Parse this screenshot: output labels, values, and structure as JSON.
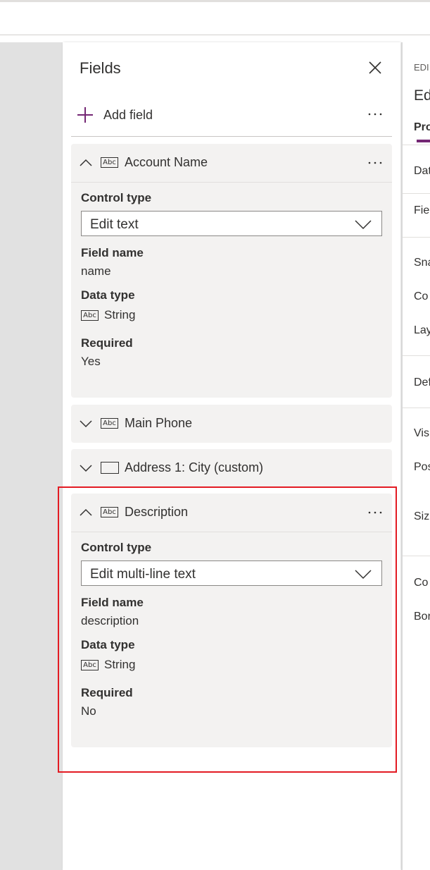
{
  "panel": {
    "title": "Fields",
    "add_field_label": "Add field"
  },
  "cards": [
    {
      "name": "Account Name",
      "expanded": true,
      "icon": "abc-text-icon",
      "control_type_label": "Control type",
      "control_type_value": "Edit text",
      "field_name_label": "Field name",
      "field_name_value": "name",
      "data_type_label": "Data type",
      "data_type_value": "String",
      "required_label": "Required",
      "required_value": "Yes"
    },
    {
      "name": "Main Phone",
      "expanded": false,
      "icon": "abc-text-icon"
    },
    {
      "name": "Address 1: City (custom)",
      "expanded": false,
      "icon": "box-icon"
    },
    {
      "name": "Description",
      "expanded": true,
      "icon": "abc-text-icon",
      "control_type_label": "Control type",
      "control_type_value": "Edit multi-line text",
      "field_name_label": "Field name",
      "field_name_value": "description",
      "data_type_label": "Data type",
      "data_type_value": "String",
      "required_label": "Required",
      "required_value": "No"
    }
  ],
  "abc_glyph": "Abc",
  "right_pane": {
    "header_small": "EDI",
    "header_large": "Ed",
    "tab": "Pro",
    "rows": [
      "Dat",
      "Fie",
      "Sna",
      "Co",
      "Lay",
      "Def",
      "Vis",
      "Pos",
      "Siz",
      "Co",
      "Bor"
    ]
  },
  "colors": {
    "accent": "#742774",
    "highlight": "#e31b23",
    "card_bg": "#f3f2f1"
  }
}
